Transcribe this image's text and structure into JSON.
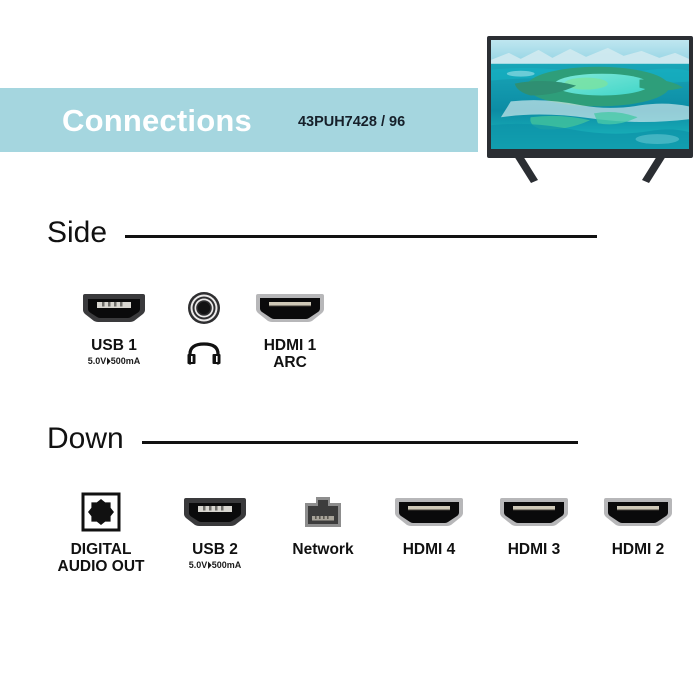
{
  "banner": {
    "title": "Connections",
    "model": "43PUH7428 / 96",
    "background_color": "#a5d6df",
    "title_color": "#ffffff",
    "model_color": "#16202a"
  },
  "product_image": {
    "name": "television",
    "screen_content": "tropical island lagoon with turquoise water",
    "bezel_color": "#2b2e33"
  },
  "sections": [
    {
      "id": "side",
      "heading": "Side",
      "ports": [
        {
          "icon": "usb-port-icon",
          "label": "USB 1",
          "sub": "5.0V⏵500mA",
          "glyph": ""
        },
        {
          "icon": "headphone-jack-icon",
          "label": "",
          "sub": "",
          "glyph": "headphones-icon"
        },
        {
          "icon": "hdmi-port-icon",
          "label": "HDMI 1\nARC",
          "sub": "",
          "glyph": ""
        }
      ]
    },
    {
      "id": "down",
      "heading": "Down",
      "ports": [
        {
          "icon": "optical-audio-out-icon",
          "label": "DIGITAL\nAUDIO OUT",
          "sub": "",
          "glyph": ""
        },
        {
          "icon": "usb-port-icon",
          "label": "USB 2",
          "sub": "5.0V⏵500mA",
          "glyph": ""
        },
        {
          "icon": "network-rj45-icon",
          "label": "Network",
          "sub": "",
          "glyph": ""
        },
        {
          "icon": "hdmi-port-icon",
          "label": "HDMI 4",
          "sub": "",
          "glyph": ""
        },
        {
          "icon": "hdmi-port-icon",
          "label": "HDMI 3",
          "sub": "",
          "glyph": ""
        },
        {
          "icon": "hdmi-port-icon",
          "label": "HDMI 2",
          "sub": "",
          "glyph": ""
        }
      ]
    }
  ]
}
